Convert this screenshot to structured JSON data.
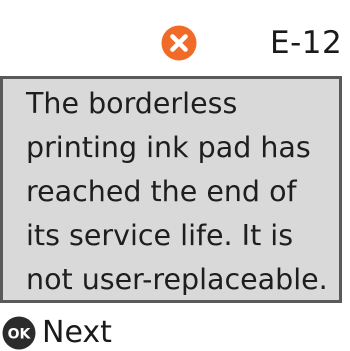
{
  "header": {
    "status_icon": "error-x-icon",
    "status_color": "#f06a28",
    "error_code": "E-12"
  },
  "message": {
    "text": "The borderless\nprinting ink pad has\nreached the end of\nits service life. It is\nnot user-replaceable."
  },
  "footer": {
    "button_icon": "ok-icon",
    "button_icon_label": "OK",
    "button_label": "Next"
  }
}
